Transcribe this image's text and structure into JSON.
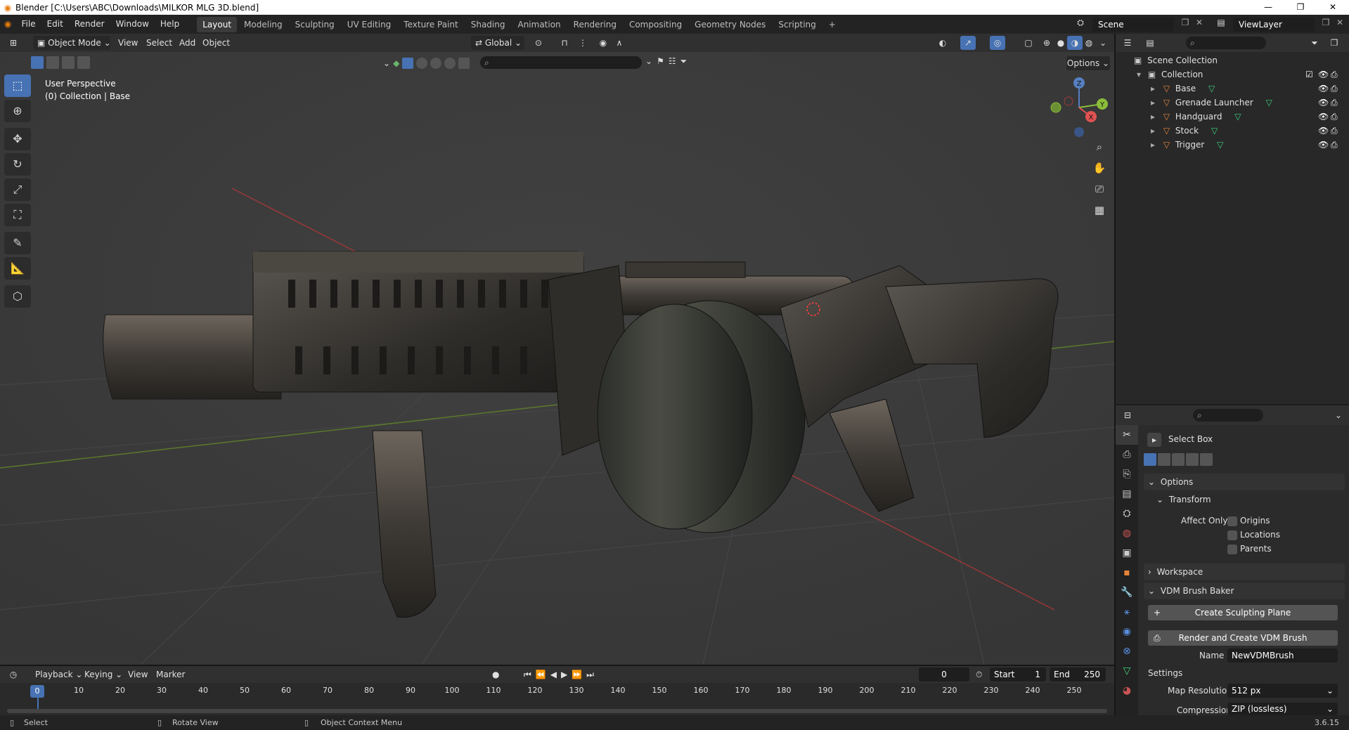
{
  "window": {
    "title": "Blender [C:\\Users\\ABC\\Downloads\\MILKOR MLG 3D.blend]"
  },
  "menu": [
    "File",
    "Edit",
    "Render",
    "Window",
    "Help"
  ],
  "workspaces": [
    "Layout",
    "Modeling",
    "Sculpting",
    "UV Editing",
    "Texture Paint",
    "Shading",
    "Animation",
    "Rendering",
    "Compositing",
    "Geometry Nodes",
    "Scripting"
  ],
  "active_workspace": "Layout",
  "scene": {
    "name": "Scene",
    "view_layer": "ViewLayer"
  },
  "viewport_header": {
    "mode": "Object Mode",
    "menus": [
      "View",
      "Select",
      "Add",
      "Object"
    ],
    "orientation": "Global",
    "options": "Options"
  },
  "viewport_info": {
    "line1": "User Perspective",
    "line2": "(0) Collection | Base"
  },
  "gizmo_axes": {
    "z": "Z",
    "y": "Y",
    "x": "X"
  },
  "outliner": {
    "root": "Scene Collection",
    "collection": "Collection",
    "objects": [
      "Base",
      "Grenade Launcher",
      "Handguard",
      "Stock",
      "Trigger"
    ]
  },
  "properties": {
    "tool_name": "Select Box",
    "options_label": "Options",
    "transform_label": "Transform",
    "affect_only_label": "Affect Only",
    "affect_options": [
      "Origins",
      "Locations",
      "Parents"
    ],
    "workspace_label": "Workspace",
    "vdm_label": "VDM Brush Baker",
    "create_plane_btn": "Create Sculpting Plane",
    "render_vdm_btn": "Render and Create VDM Brush",
    "name_label": "Name",
    "name_value": "NewVDMBrush",
    "settings_label": "Settings",
    "map_res_label": "Map Resolution",
    "map_res_value": "512 px",
    "compression_label": "Compression",
    "compression_value": "ZIP (lossless)"
  },
  "timeline": {
    "menus": [
      "Playback",
      "Keying",
      "View",
      "Marker"
    ],
    "current_frame": "0",
    "start_label": "Start",
    "start_value": "1",
    "end_label": "End",
    "end_value": "250",
    "ruler": [
      "0",
      "10",
      "20",
      "30",
      "40",
      "50",
      "60",
      "70",
      "80",
      "90",
      "100",
      "110",
      "120",
      "130",
      "140",
      "150",
      "160",
      "170",
      "180",
      "190",
      "200",
      "210",
      "220",
      "230",
      "240",
      "250"
    ]
  },
  "statusbar": {
    "select": "Select",
    "rotate": "Rotate View",
    "context": "Object Context Menu",
    "version": "3.6.15"
  }
}
